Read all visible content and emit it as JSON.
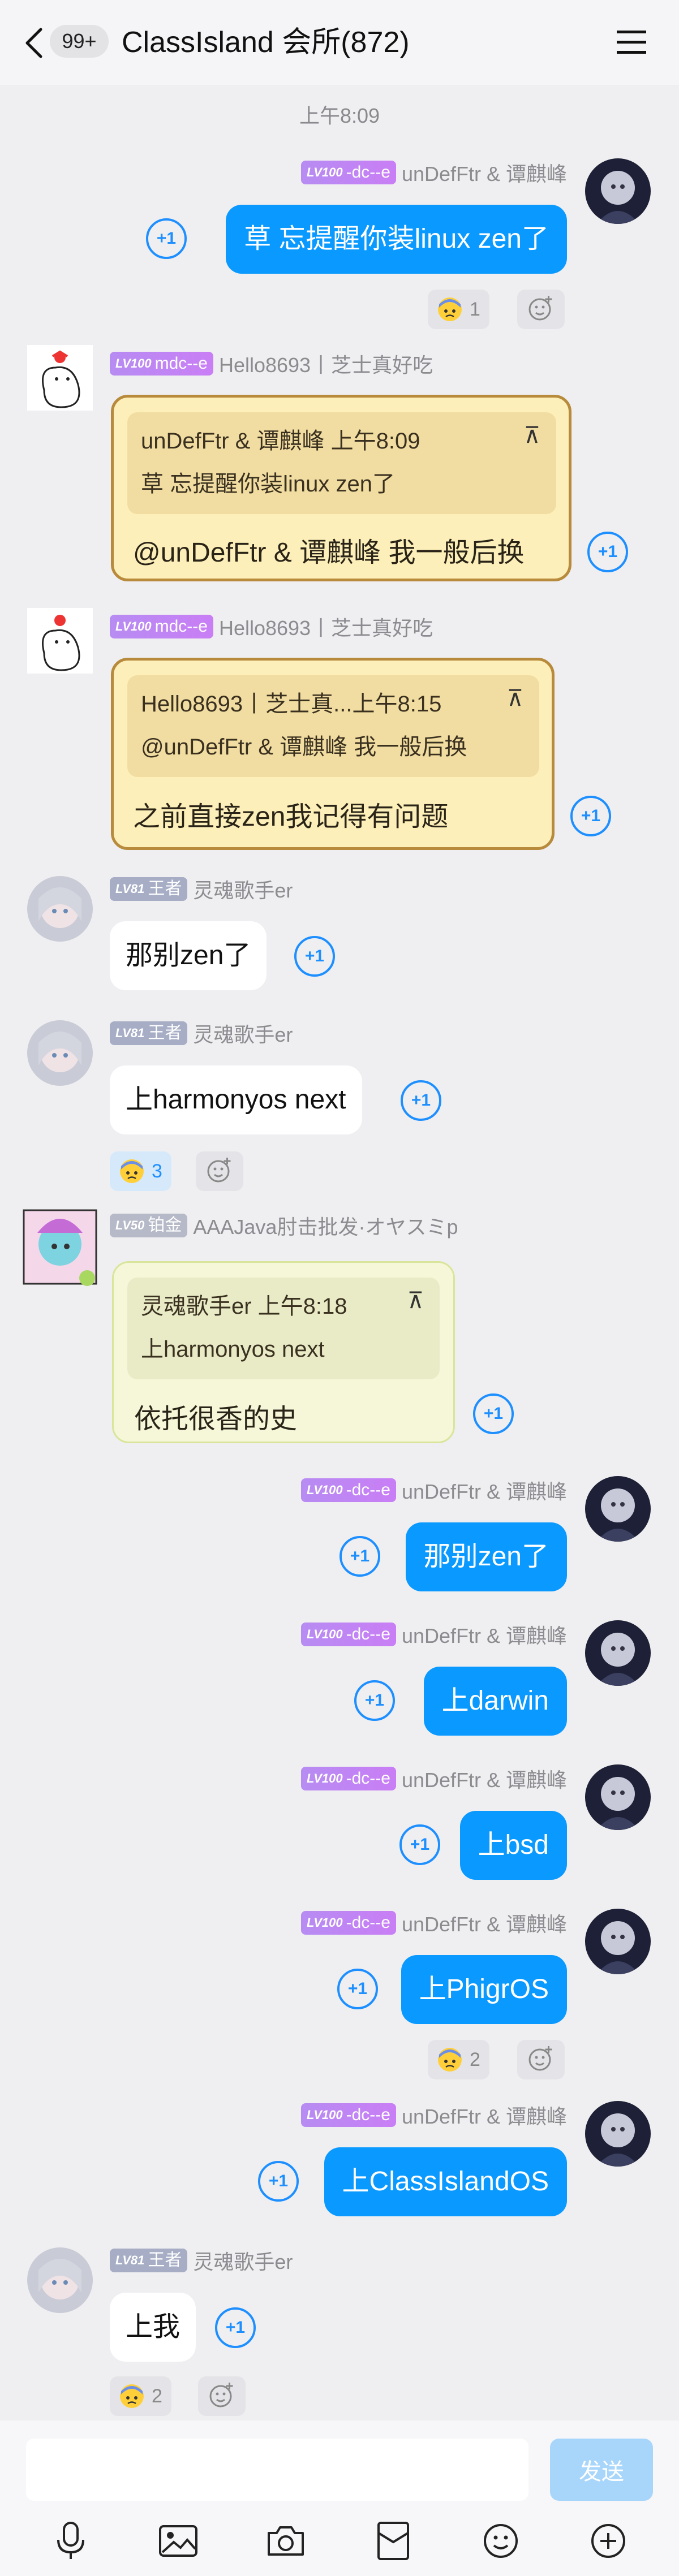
{
  "header": {
    "unread": "99+",
    "title": "ClassIsland 会所(872)"
  },
  "timestamp": "上午8:09",
  "sender_udf": {
    "level": "LV100",
    "title": "-dc--e",
    "name": "unDefFtr & 谭麒峰"
  },
  "sender_hello": {
    "level": "LV100",
    "title": "mdc--e",
    "name": "Hello8693丨芝士真好吃"
  },
  "sender_soul": {
    "level": "LV81",
    "title": "王者",
    "name": "灵魂歌手er"
  },
  "sender_aaa": {
    "level": "LV50",
    "title": "铂金",
    "name": "AAAJava肘击批发·オヤスミp"
  },
  "messages": {
    "m1": {
      "text": "草 忘提醒你装linux zen了",
      "react_count": "1"
    },
    "m2": {
      "quote_head": "unDefFtr & 谭麒峰 上午8:09",
      "quote_body": "草 忘提醒你装linux zen了",
      "text": "@unDefFtr & 谭麒峰 我一般后换"
    },
    "m3": {
      "quote_head": "Hello8693丨芝士真...上午8:15",
      "quote_body": "@unDefFtr & 谭麒峰 我一般后换",
      "text": "之前直接zen我记得有问题"
    },
    "m4": {
      "text": "那别zen了"
    },
    "m5": {
      "text": "上harmonyos next",
      "react_count": "3"
    },
    "m6": {
      "quote_head": "灵魂歌手er 上午8:18",
      "quote_body": "上harmonyos next",
      "text": "依托很香的史"
    },
    "m7": {
      "text": "那别zen了"
    },
    "m8": {
      "text": "上darwin"
    },
    "m9": {
      "text": "上bsd"
    },
    "m10": {
      "text": "上PhigrOS",
      "react_count": "2"
    },
    "m11": {
      "text": "上ClassIslandOS"
    },
    "m12": {
      "text": "上我",
      "react_count": "2"
    }
  },
  "labels": {
    "plus_one": "+1",
    "pin": "⊼"
  },
  "input": {
    "placeholder": "",
    "send": "发送"
  },
  "colors": {
    "bubble_blue": "#0a99ff",
    "accent": "#1e8fff"
  }
}
